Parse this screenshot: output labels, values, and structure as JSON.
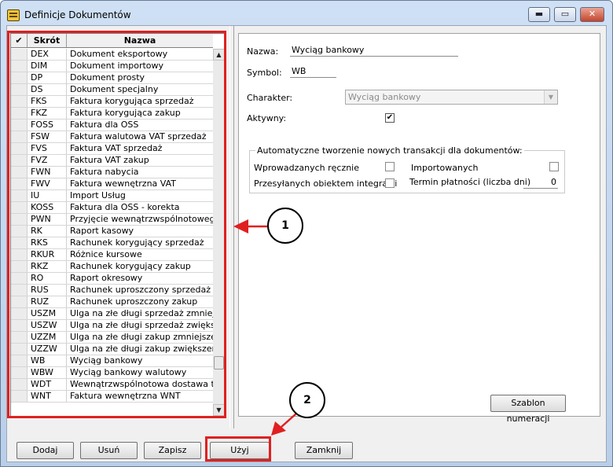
{
  "window": {
    "title": "Definicje Dokumentów",
    "controls": {
      "minimize": "▬",
      "maximize": "▭",
      "close": "✕"
    }
  },
  "grid": {
    "headers": {
      "check": "✔",
      "skrot": "Skrót",
      "nazwa": "Nazwa"
    },
    "rows": [
      {
        "skrot": "DEX",
        "nazwa": "Dokument eksportowy"
      },
      {
        "skrot": "DIM",
        "nazwa": "Dokument importowy"
      },
      {
        "skrot": "DP",
        "nazwa": "Dokument prosty"
      },
      {
        "skrot": "DS",
        "nazwa": "Dokument specjalny"
      },
      {
        "skrot": "FKS",
        "nazwa": "Faktura korygująca sprzedaż"
      },
      {
        "skrot": "FKZ",
        "nazwa": "Faktura korygująca zakup"
      },
      {
        "skrot": "FOSS",
        "nazwa": "Faktura dla OSS"
      },
      {
        "skrot": "FSW",
        "nazwa": "Faktura walutowa VAT sprzedaż"
      },
      {
        "skrot": "FVS",
        "nazwa": "Faktura VAT sprzedaż"
      },
      {
        "skrot": "FVZ",
        "nazwa": "Faktura VAT zakup"
      },
      {
        "skrot": "FWN",
        "nazwa": "Faktura nabycia"
      },
      {
        "skrot": "FWV",
        "nazwa": "Faktura wewnętrzna VAT"
      },
      {
        "skrot": "IU",
        "nazwa": "Import Usług"
      },
      {
        "skrot": "KOSS",
        "nazwa": "Faktura dla OSS - korekta"
      },
      {
        "skrot": "PWN",
        "nazwa": "Przyjęcie wewnątrzwspólnotowego n"
      },
      {
        "skrot": "RK",
        "nazwa": "Raport kasowy"
      },
      {
        "skrot": "RKS",
        "nazwa": "Rachunek korygujący sprzedaż"
      },
      {
        "skrot": "RKUR",
        "nazwa": "Różnice kursowe"
      },
      {
        "skrot": "RKZ",
        "nazwa": "Rachunek korygujący zakup"
      },
      {
        "skrot": "RO",
        "nazwa": "Raport okresowy"
      },
      {
        "skrot": "RUS",
        "nazwa": "Rachunek uproszczony sprzedaż"
      },
      {
        "skrot": "RUZ",
        "nazwa": "Rachunek uproszczony zakup"
      },
      {
        "skrot": "USZM",
        "nazwa": "Ulga na złe długi sprzedaż zmniejsze"
      },
      {
        "skrot": "USZW",
        "nazwa": "Ulga na złe długi sprzedaż zwiększe"
      },
      {
        "skrot": "UZZM",
        "nazwa": "Ulga na złe długi zakup zmniejszenie"
      },
      {
        "skrot": "UZZW",
        "nazwa": "Ulga na złe długi zakup zwiększenie"
      },
      {
        "skrot": "WB",
        "nazwa": "Wyciąg bankowy"
      },
      {
        "skrot": "WBW",
        "nazwa": "Wyciąg bankowy walutowy"
      },
      {
        "skrot": "WDT",
        "nazwa": "Wewnątrzwspólnotowa dostawa tow"
      },
      {
        "skrot": "WNT",
        "nazwa": "Faktura wewnętrzna WNT"
      }
    ],
    "selected_index": 26,
    "scroll_up": "▲",
    "scroll_down": "▼"
  },
  "detail": {
    "nazwa_label": "Nazwa:",
    "nazwa_value": "Wyciąg bankowy",
    "symbol_label": "Symbol:",
    "symbol_value": "WB",
    "charakter_label": "Charakter:",
    "charakter_value": "Wyciąg bankowy",
    "combo_arrow": "▼",
    "aktywny_label": "Aktywny:",
    "aktywny_checked": "✔",
    "group_title": "Automatyczne tworzenie nowych transakcji dla dokumentów:",
    "wprowadzanych_label": "Wprowadzanych ręcznie",
    "importowanych_label": "Importowanych",
    "przesylanych_label": "Przesyłanych obiektem integracji",
    "termin_label": "Termin płatności (liczba dni)",
    "termin_value": "0",
    "szablon_button": "Szablon numeracji"
  },
  "buttons": {
    "dodaj": "Dodaj",
    "usun": "Usuń",
    "zapisz": "Zapisz",
    "uzyj": "Użyj",
    "zamknij": "Zamknij"
  },
  "annotations": {
    "callout1": "1",
    "callout2": "2",
    "highlight_color": "#e02020"
  }
}
